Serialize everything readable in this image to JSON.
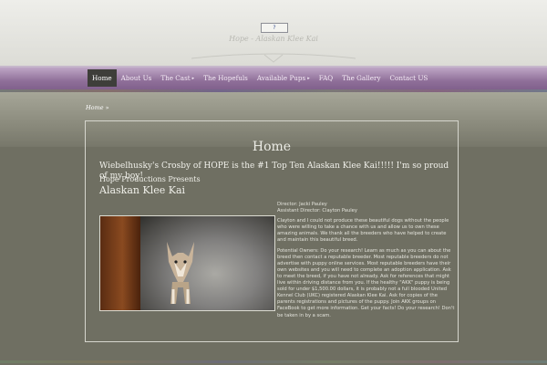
{
  "header": {
    "logo_icon": "broken-image-icon",
    "site_title": "Hope - Alaskan Klee Kai"
  },
  "nav": {
    "items": [
      {
        "label": "Home",
        "active": true,
        "submenu": false
      },
      {
        "label": "About Us",
        "active": false,
        "submenu": false
      },
      {
        "label": "The Cast",
        "active": false,
        "submenu": true
      },
      {
        "label": "The Hopefuls",
        "active": false,
        "submenu": false
      },
      {
        "label": "Available Pups",
        "active": false,
        "submenu": true
      },
      {
        "label": "FAQ",
        "active": false,
        "submenu": false
      },
      {
        "label": "The Gallery",
        "active": false,
        "submenu": false
      },
      {
        "label": "Contact US",
        "active": false,
        "submenu": false
      }
    ],
    "submenu_glyph": "▸"
  },
  "breadcrumb": {
    "home": "Home",
    "separator": "»"
  },
  "main": {
    "title": "Home",
    "announcement": "Wiebelhusky's Crosby of HOPE is the #1 Top Ten Alaskan Klee Kai!!!!! I'm so proud of my boy!",
    "presents": "Hope Productions Presents",
    "breed": "Alaskan Klee Kai",
    "photo_icon": "puppy-photo",
    "director": "Director: Jacki Pauley",
    "assistant_director": "Assistant Director: Clayton Pauley",
    "paragraph1": "Clayton and I could not produce these beautiful dogs without the people who were willing to take a chance with us and allow us to own these amazing animals.  We thank all the breeders who have helped to create and maintain this beautiful breed.",
    "paragraph2": "Potential Owners:  Do your research!  Learn as much as you can about the breed then contact a reputable breeder.  Most reputable breeders do not advertise with puppy online services.  Most reputable breeders have their own websites and you will need to complete an adoption application.  Ask to meet the breed, if you have not already.  Ask for references that might live within driving distance from you.  If the healthy \"AKK\" puppy is being sold for under $1,500.00 dollars, it is probably not a full blooded United Kennel Club (UKC) registered Alaskan Klee Kai.  Ask for copies of the parents registrations and pictures of the puppy.  Join AKK groups on FaceBook to get more information.  Get your facts!  Do your research!  Don't be taken in by a scam."
  },
  "colors": {
    "nav_purple": "#8f6f99",
    "page_olive": "#6f6f62",
    "active_tab": "#3e3e3a"
  }
}
